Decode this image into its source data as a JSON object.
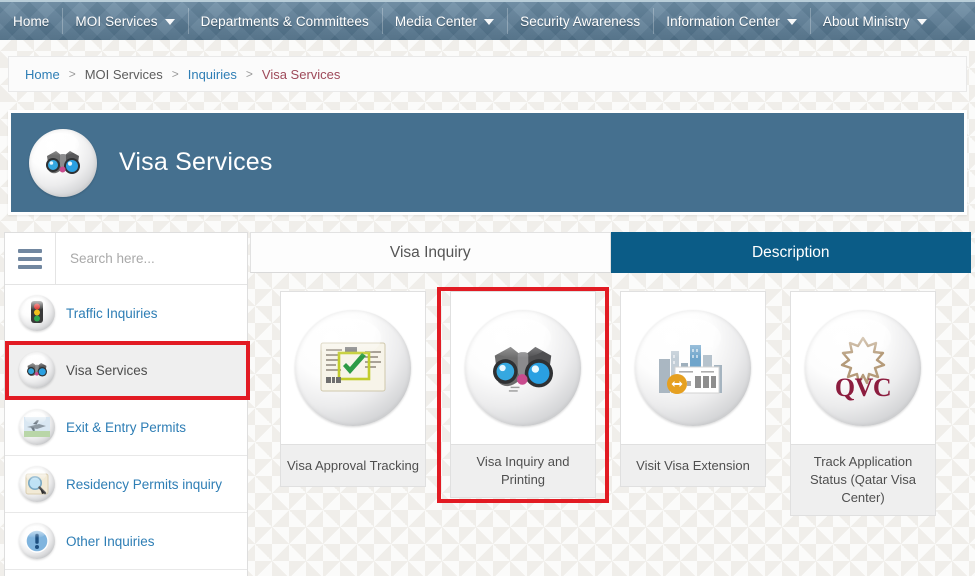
{
  "topnav": {
    "items": [
      {
        "label": "Home",
        "has_caret": false
      },
      {
        "label": "MOI Services",
        "has_caret": true
      },
      {
        "label": "Departments & Committees",
        "has_caret": false
      },
      {
        "label": "Media Center",
        "has_caret": true
      },
      {
        "label": "Security Awareness",
        "has_caret": false
      },
      {
        "label": "Information Center",
        "has_caret": true
      },
      {
        "label": "About Ministry",
        "has_caret": true
      }
    ]
  },
  "breadcrumb": {
    "separator": ">",
    "items": [
      {
        "label": "Home",
        "style": "link"
      },
      {
        "label": "MOI Services",
        "style": "plain"
      },
      {
        "label": "Inquiries",
        "style": "link"
      },
      {
        "label": "Visa Services",
        "style": "current"
      }
    ]
  },
  "banner": {
    "title": "Visa Services",
    "icon": "binoculars-icon",
    "background_color": "#45708f"
  },
  "sidebar": {
    "search": {
      "placeholder": "Search here...",
      "value": ""
    },
    "menu_icon": "hamburger-icon",
    "items": [
      {
        "label": "Traffic Inquiries",
        "icon": "traffic-light-icon",
        "active": false
      },
      {
        "label": "Visa Services",
        "icon": "binoculars-icon",
        "active": true
      },
      {
        "label": "Exit & Entry Permits",
        "icon": "airplane-icon",
        "active": false
      },
      {
        "label": "Residency Permits inquiry",
        "icon": "magnifier-icon",
        "active": false
      },
      {
        "label": "Other Inquiries",
        "icon": "exclamation-icon",
        "active": false
      }
    ]
  },
  "tabs": [
    {
      "label": "Visa Inquiry",
      "active": false
    },
    {
      "label": "Description",
      "active": true
    }
  ],
  "cards": [
    {
      "label": "Visa Approval Tracking",
      "icon": "document-check-icon",
      "highlighted": false
    },
    {
      "label": "Visa Inquiry and Printing",
      "icon": "binoculars-icon",
      "highlighted": true
    },
    {
      "label": "Visit Visa Extension",
      "icon": "city-extension-icon",
      "highlighted": false
    },
    {
      "label": "Track Application Status (Qatar Visa Center)",
      "icon": "qvc-logo-icon",
      "highlighted": false
    }
  ],
  "annotations": [
    {
      "name": "sidebar-visa-services-highlight",
      "color": "#e21b23"
    },
    {
      "name": "card-visa-inquiry-highlight",
      "color": "#e21b23"
    }
  ],
  "colors": {
    "nav_background": "#5a7e99",
    "banner_blue": "#45708f",
    "active_tab_blue": "#0b5c87",
    "link_blue": "#2e7eb5",
    "annotation_red": "#e21b23"
  }
}
